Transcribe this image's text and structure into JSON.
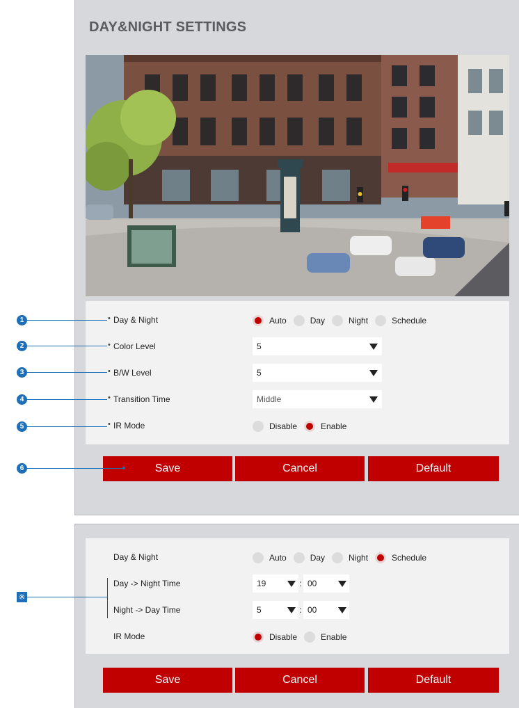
{
  "panel_title": "DAY&NIGHT SETTINGS",
  "settings": {
    "day_night": {
      "label": "Day & Night",
      "options": [
        "Auto",
        "Day",
        "Night",
        "Schedule"
      ],
      "selected": "Auto"
    },
    "color_level": {
      "label": "Color Level",
      "value": "5"
    },
    "bw_level": {
      "label": "B/W Level",
      "value": "5"
    },
    "transition_time": {
      "label": "Transition Time",
      "value": "Middle"
    },
    "ir_mode": {
      "label": "IR Mode",
      "options": [
        "Disable",
        "Enable"
      ],
      "selected": "Enable"
    }
  },
  "buttons": {
    "save": "Save",
    "cancel": "Cancel",
    "default": "Default"
  },
  "schedule": {
    "day_night": {
      "label": "Day & Night",
      "options": [
        "Auto",
        "Day",
        "Night",
        "Schedule"
      ],
      "selected": "Schedule"
    },
    "day_to_night": {
      "label": "Day -> Night Time",
      "hour": "19",
      "minute": "00",
      "sep": ":"
    },
    "night_to_day": {
      "label": "Night -> Day Time",
      "hour": "5",
      "minute": "00",
      "sep": ":"
    },
    "ir_mode": {
      "label": "IR Mode",
      "options": [
        "Disable",
        "Enable"
      ],
      "selected": "Disable"
    }
  },
  "markers": [
    "1",
    "2",
    "3",
    "4",
    "5",
    "6"
  ],
  "note_marker": "※",
  "colors": {
    "accent": "#c00000",
    "marker": "#1e6eb8",
    "panel": "#d6d8dc"
  }
}
